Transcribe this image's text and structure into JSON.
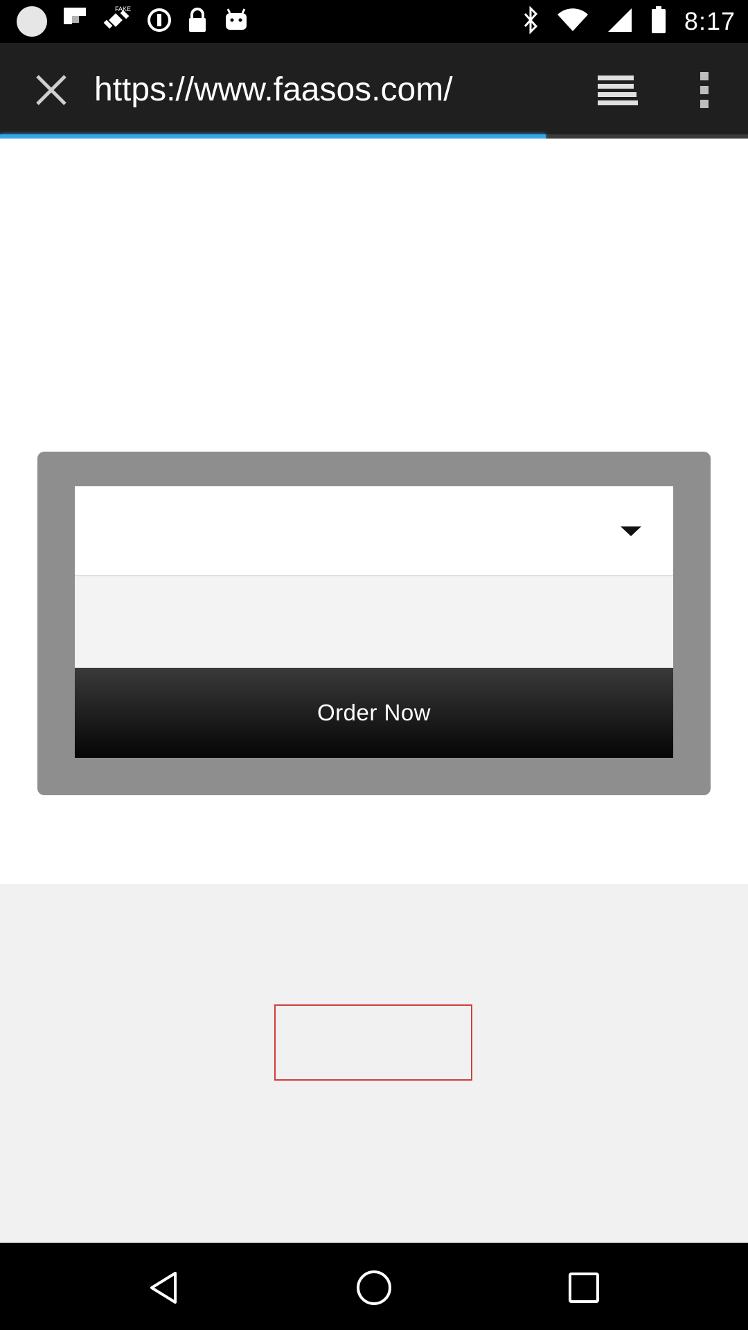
{
  "status_bar": {
    "time": "8:17",
    "left_icons": [
      "notification-dot-icon",
      "flipboard-icon",
      "fake-gps-icon",
      "data-saver-icon",
      "lock-icon",
      "android-icon"
    ],
    "right_icons": [
      "bluetooth-icon",
      "wifi-icon",
      "signal-icon",
      "battery-icon"
    ]
  },
  "toolbar": {
    "url": "https://www.faasos.com/",
    "close_icon": "close-icon",
    "reader_icon": "reader-mode-icon",
    "more_icon": "more-vert-icon"
  },
  "page_load_progress": 0.73,
  "webpage": {
    "location_select_value": "",
    "second_field_value": "",
    "order_button_label": "Order Now"
  },
  "nav_bar": {
    "back_icon": "back-icon",
    "home_icon": "home-icon",
    "recents_icon": "recents-icon"
  },
  "colors": {
    "progress": "#36a7e8",
    "toolbar": "#1f1f1f",
    "card": "#8e8e8e",
    "red_outline": "#d33c3c"
  }
}
